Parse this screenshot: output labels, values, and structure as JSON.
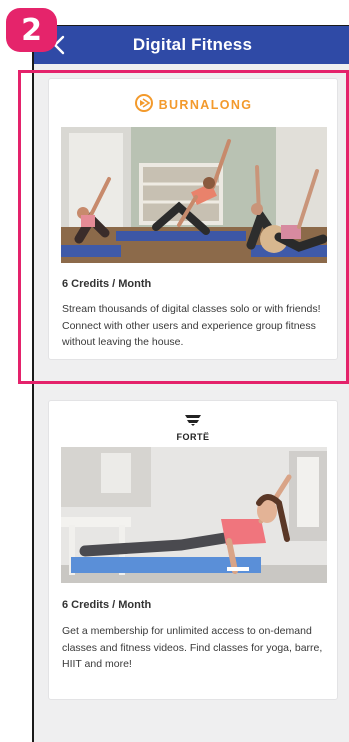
{
  "step_badge": "2",
  "header": {
    "title": "Digital Fitness",
    "back_icon": "chevron-left-icon",
    "color": "#2f4aa6"
  },
  "highlight_color": "#e4226b",
  "cards": [
    {
      "logo_text": "BURNALONG",
      "logo_icon": "burnalong-logo-icon",
      "credits": "6 Credits / Month",
      "description": "Stream thousands of digital classes solo or with friends! Connect with other users and experience group fitness without leaving the house."
    },
    {
      "logo_text": "FORTË",
      "logo_icon": "forte-logo-icon",
      "credits": "6 Credits / Month",
      "description": "Get a membership for unlimited access to on-demand classes and fitness videos. Find classes for yoga, barre, HIIT and more!"
    }
  ]
}
